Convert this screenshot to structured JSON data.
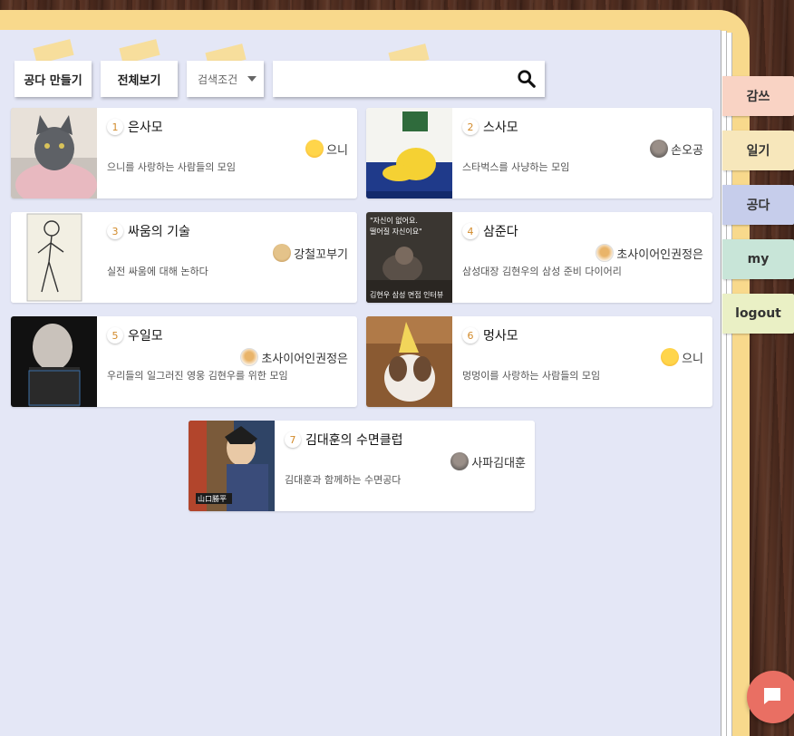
{
  "toolbar": {
    "create_label": "공다 만들기",
    "view_all_label": "전체보기",
    "search_condition": "검색조건",
    "search_value": ""
  },
  "tabs": [
    {
      "label": "감쓰",
      "color": "#f9d3c4"
    },
    {
      "label": "일기",
      "color": "#f7e7bb"
    },
    {
      "label": "공다",
      "color": "#c6cdeb"
    },
    {
      "label": "my",
      "color": "#c8e5d8"
    },
    {
      "label": "logout",
      "color": "#eaf0c5"
    }
  ],
  "cards": [
    {
      "num": "1",
      "title": "은사모",
      "owner": "으니",
      "desc": "으니를 사랑하는 사람들의 모임",
      "avatar_icon": "smiley-emoji-icon"
    },
    {
      "num": "2",
      "title": "스사모",
      "owner": "손오공",
      "desc": "스타벅스를 사냥하는 모임",
      "avatar_icon": "profile-photo-icon"
    },
    {
      "num": "3",
      "title": "싸움의 기술",
      "owner": "강철꼬부기",
      "desc": "실전 싸움에 대해 논하다",
      "avatar_icon": "dog-avatar-icon"
    },
    {
      "num": "4",
      "title": "삼준다",
      "owner": "초사이어인권정은",
      "desc": "삼성대장 김현우의 삼성 준비 다이어리",
      "avatar_icon": "fighter-avatar-icon"
    },
    {
      "num": "5",
      "title": "우일모",
      "owner": "초사이어인권정은",
      "desc": "우리들의 일그러진 영웅 김현우를 위한 모임",
      "avatar_icon": "fighter-avatar-icon"
    },
    {
      "num": "6",
      "title": "멍사모",
      "owner": "으니",
      "desc": "멍멍이를 사랑하는 사람들의 모임",
      "avatar_icon": "smiley-emoji-icon"
    },
    {
      "num": "7",
      "title": "김대훈의 수면클럽",
      "owner": "사파김대훈",
      "desc": "김대훈과 함께하는 수면공다",
      "avatar_icon": "profile-photo-icon"
    }
  ],
  "thumb_texts": {
    "card4_top": "\"자신이 없어요.\n떨어질 자신이요\"",
    "card4_bottom": "김현우 삼성 면접 인터뷰",
    "card7_caption": "山口勝平"
  },
  "colors": {
    "paper": "#e4e7f6",
    "binder": "#f8d98c",
    "chat_button": "#e96f63",
    "number_accent": "#d28a2a"
  }
}
